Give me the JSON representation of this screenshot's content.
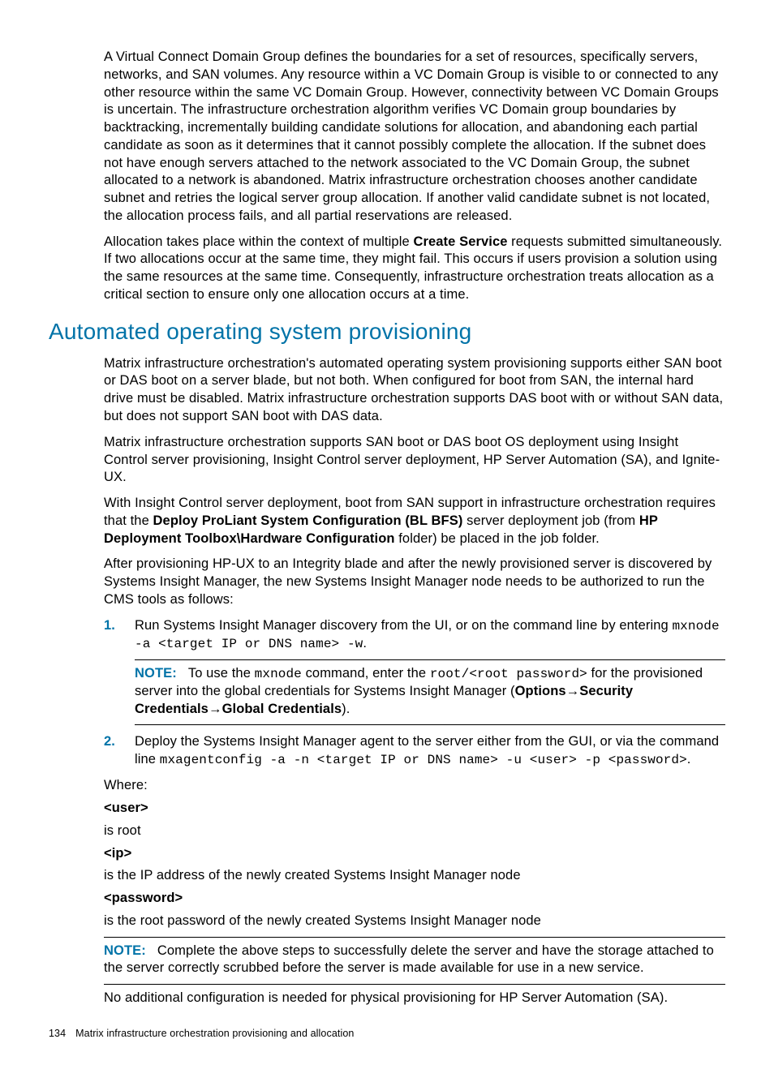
{
  "para1_a": "A Virtual Connect Domain Group defines the boundaries for a set of resources, specifically servers, networks, and SAN volumes. Any resource within a VC Domain Group is visible to or connected to any other resource within the same VC Domain Group. However, connectivity between VC Domain Groups is uncertain. The infrastructure orchestration algorithm verifies VC Domain group boundaries by backtracking, incrementally building candidate solutions for allocation, and abandoning each partial candidate as soon as it determines that it cannot possibly complete the allocation. If the subnet does not have enough servers attached to the network associated to the VC Domain Group, the subnet allocated to a network is abandoned. Matrix infrastructure orchestration chooses another candidate subnet and retries the logical server group allocation. If another valid candidate subnet is not located, the allocation process fails, and all partial reservations are released.",
  "para2": {
    "a": "Allocation takes place within the context of multiple ",
    "b": "Create Service",
    "c": " requests submitted simultaneously. If two allocations occur at the same time, they might fail. This occurs if users provision a solution using the same resources at the same time. Consequently, infrastructure orchestration treats allocation as a critical section to ensure only one allocation occurs at a time."
  },
  "h2": "Automated operating system provisioning",
  "para3": "Matrix infrastructure orchestration's automated operating system provisioning supports either SAN boot or DAS boot on a server blade, but not both. When configured for boot from SAN, the internal hard drive must be disabled. Matrix infrastructure orchestration supports DAS boot with or without SAN data, but does not support SAN boot with DAS data.",
  "para4": "Matrix infrastructure orchestration supports SAN boot or DAS boot OS deployment using Insight Control server provisioning, Insight Control server deployment, HP Server Automation (SA), and Ignite-UX.",
  "para5": {
    "a": "With Insight Control server deployment, boot from SAN support in infrastructure orchestration requires that the ",
    "b": "Deploy ProLiant System Configuration (BL BFS)",
    "c": " server deployment job (from ",
    "d": "HP Deployment Toolbox\\Hardware Configuration",
    "e": " folder) be placed in the job folder."
  },
  "para6": "After provisioning HP-UX to an Integrity blade and after the newly provisioned server is discovered by Systems Insight Manager, the new Systems Insight Manager node needs to be authorized to run the CMS tools as follows:",
  "step1": {
    "num": "1.",
    "a": "Run Systems Insight Manager discovery from the UI, or on the command line by entering ",
    "cmd": "mxnode -a <target IP or DNS name> -w",
    "dot": "."
  },
  "note1": {
    "label": "NOTE:",
    "a": "To use the ",
    "m1": "mxnode",
    "b": " command, enter the ",
    "m2": "root/<root password>",
    "c": " for the provisioned server into the global credentials for Systems Insight Manager (",
    "d": "Options",
    "arrow1": "→",
    "e": "Security Credentials",
    "arrow2": "→",
    "f": "Global Credentials",
    "g": ")."
  },
  "step2": {
    "num": "2.",
    "a": "Deploy the Systems Insight Manager agent to the server either from the GUI, or via the command line ",
    "cmd": "mxagentconfig -a -n <target IP or DNS name> -u <user> -p <password>",
    "dot": "."
  },
  "where": {
    "label": "Where:",
    "user_k": "<user>",
    "user_v": "is root",
    "ip_k": "<ip>",
    "ip_v": "is the IP address of the newly created Systems Insight Manager node",
    "pw_k": "<password>",
    "pw_v": "is the root password of the newly created Systems Insight Manager node"
  },
  "note2": {
    "label": "NOTE:",
    "text": "Complete the above steps to successfully delete the server and have the storage attached to the server correctly scrubbed before the server is made available for use in a new service."
  },
  "para_last": "No additional configuration is needed for physical provisioning for HP Server Automation (SA).",
  "footer": {
    "page": "134",
    "title": "Matrix infrastructure orchestration provisioning and allocation"
  }
}
